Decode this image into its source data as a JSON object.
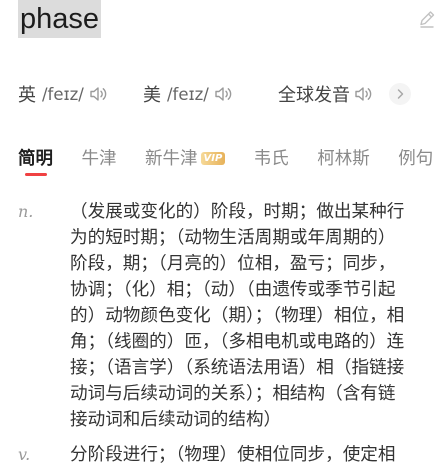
{
  "word": "phase",
  "pronunciations": {
    "uk": {
      "label": "英",
      "phonetic": "/feɪz/"
    },
    "us": {
      "label": "美",
      "phonetic": "/feɪz/"
    },
    "global": {
      "label": "全球发音"
    }
  },
  "icons": {
    "edit": "edit-icon",
    "speaker": "speaker-icon",
    "more": "chevron-right-icon"
  },
  "tabs": [
    {
      "label": "简明",
      "active": true
    },
    {
      "label": "牛津",
      "active": false
    },
    {
      "label": "新牛津",
      "badge": "VIP",
      "active": false
    },
    {
      "label": "韦氏",
      "active": false
    },
    {
      "label": "柯林斯",
      "active": false
    },
    {
      "label": "例句",
      "active": false
    }
  ],
  "definitions": [
    {
      "pos": "n.",
      "text": "（发展或变化的）阶段，时期；做出某种行为的短时期；（动物生活周期或年周期的）阶段，期；（月亮的）位相，盈亏；同步，协调；（化）相；（动）（由遗传或季节引起的）动物颜色变化（期）；（物理）相位，相角；（线圈的）匝，（多相电机或电路的）连接；（语言学）（系统语法用语）相（指链接动词与后续动词的关系）；相结构（含有链接动词和后续动词的结构）"
    },
    {
      "pos": "v.",
      "text": "分阶段进行；（物理）使相位同步，使定相"
    }
  ],
  "colors": {
    "accent": "#f04142",
    "highlight": "#dcdcdc",
    "vip_from": "#f6d998",
    "vip_to": "#e7b25a"
  }
}
